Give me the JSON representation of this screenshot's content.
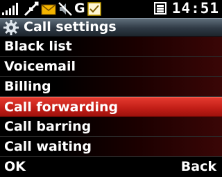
{
  "status_bar": {
    "network": "G",
    "time": "14:51",
    "icons": [
      "signal-icon",
      "data-transfer-icon",
      "message-icon",
      "mute-icon",
      "network-icon",
      "notes-icon",
      "battery-icon"
    ]
  },
  "header": {
    "icon": "gear-icon",
    "title": "Call settings"
  },
  "menu": {
    "items": [
      {
        "label": "Black list"
      },
      {
        "label": "Voicemail"
      },
      {
        "label": "Billing"
      },
      {
        "label": "Call forwarding"
      },
      {
        "label": "Call barring"
      },
      {
        "label": "Call waiting"
      }
    ],
    "selected": "Call forwarding"
  },
  "softkeys": {
    "left": "OK",
    "right": "Back"
  },
  "colors": {
    "highlight": "#d42a21",
    "title_bar": "#3b4753",
    "background": "#000000"
  }
}
